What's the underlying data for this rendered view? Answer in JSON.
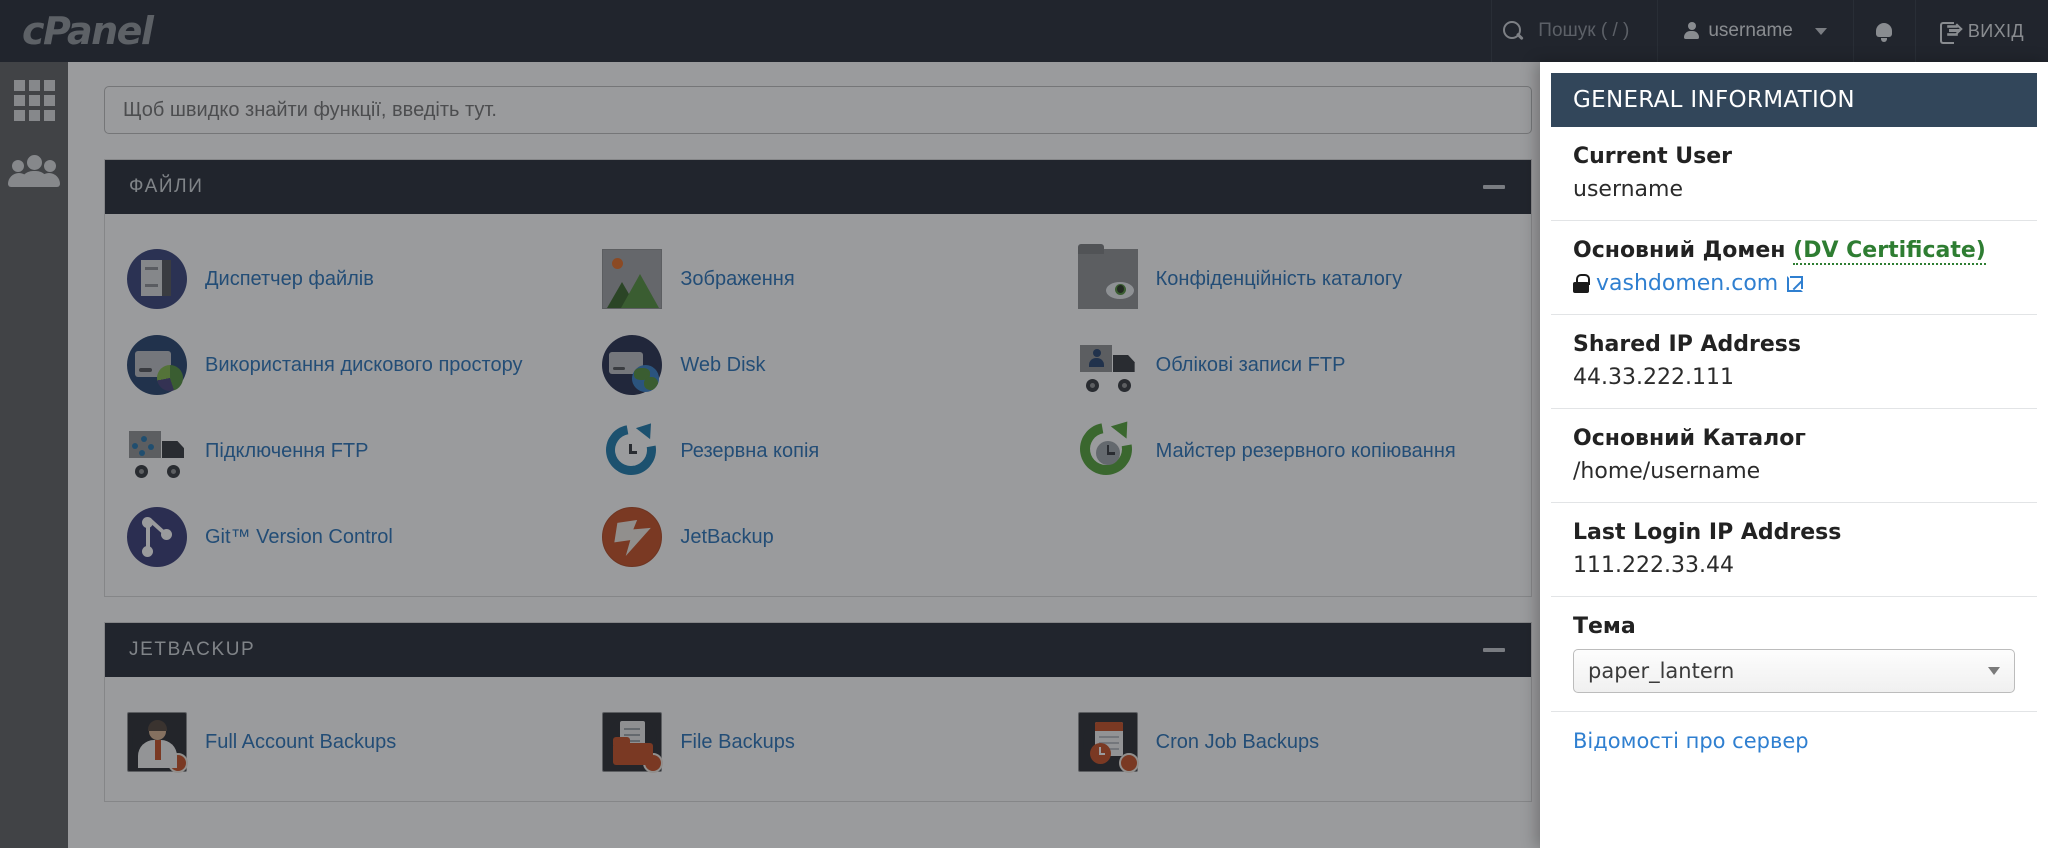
{
  "topbar": {
    "logo": "cPanel",
    "search_placeholder": "Пошук ( / )",
    "username": "username",
    "logout_label": "ВИХІД"
  },
  "quick_search": {
    "placeholder": "Щоб швидко знайти функції, введіть тут."
  },
  "sections": [
    {
      "title": "ФАЙЛИ",
      "items": [
        {
          "label": "Диспетчер файлів",
          "icon": "file-manager-icon"
        },
        {
          "label": "Зображення",
          "icon": "images-icon"
        },
        {
          "label": "Конфіденційність каталогу",
          "icon": "directory-privacy-icon"
        },
        {
          "label": "Використання дискового простору",
          "icon": "disk-usage-icon"
        },
        {
          "label": "Web Disk",
          "icon": "web-disk-icon"
        },
        {
          "label": "Облікові записи FTP",
          "icon": "ftp-accounts-icon"
        },
        {
          "label": "Підключення FTP",
          "icon": "ftp-connections-icon"
        },
        {
          "label": "Резервна копія",
          "icon": "backup-icon"
        },
        {
          "label": "Майстер резервного копіювання",
          "icon": "backup-wizard-icon"
        },
        {
          "label": "Git™ Version Control",
          "icon": "git-icon"
        },
        {
          "label": "JetBackup",
          "icon": "jetbackup-icon"
        }
      ]
    },
    {
      "title": "JETBACKUP",
      "items": [
        {
          "label": "Full Account Backups",
          "icon": "full-account-backups-icon"
        },
        {
          "label": "File Backups",
          "icon": "file-backups-icon"
        },
        {
          "label": "Cron Job Backups",
          "icon": "cron-job-backups-icon"
        }
      ]
    }
  ],
  "general_information": {
    "heading": "GENERAL INFORMATION",
    "current_user_label": "Current User",
    "current_user_value": "username",
    "primary_domain_label": "Основний Домен",
    "dv_certificate": "(DV Certificate)",
    "domain": "vashdomen.com",
    "shared_ip_label": "Shared IP Address",
    "shared_ip_value": "44.33.222.111",
    "home_directory_label": "Основний Каталог",
    "home_directory_value": "/home/username",
    "last_login_label": "Last Login IP Address",
    "last_login_value": "111.222.33.44",
    "theme_label": "Тема",
    "theme_value": "paper_lantern",
    "server_info_link": "Відомості про сервер"
  },
  "colors": {
    "topbar_bg": "#1b212c",
    "panel_header_bg": "#1b212c",
    "link_blue": "#1f6cb5",
    "gi_header_bg": "#32465a",
    "cert_green": "#2e7d32"
  }
}
